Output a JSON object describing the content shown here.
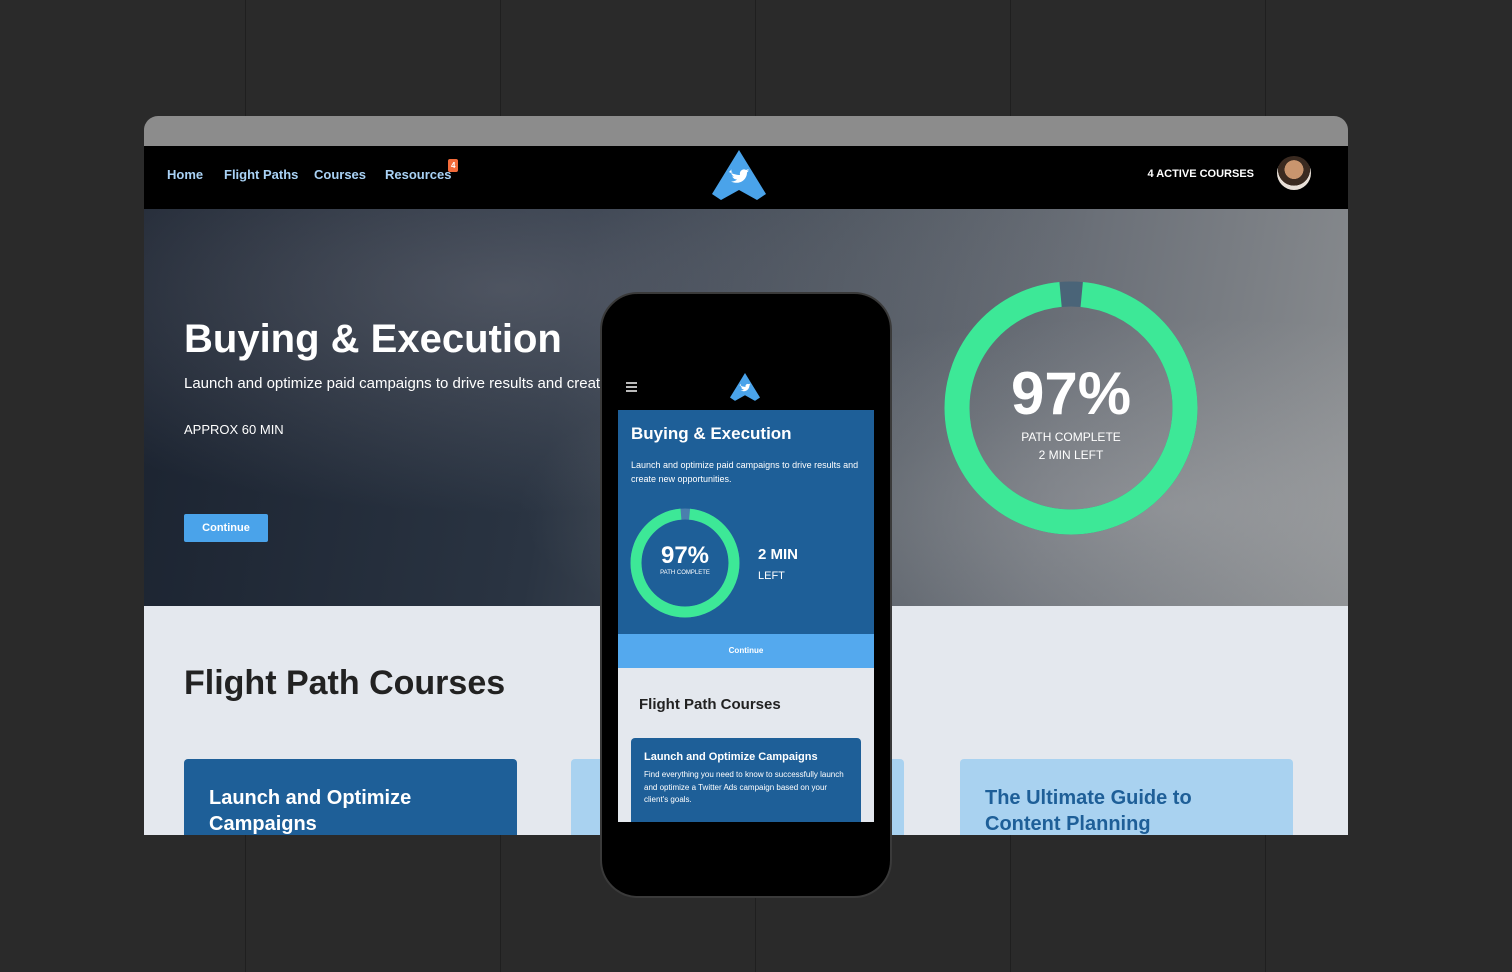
{
  "nav": {
    "items": [
      "Home",
      "Flight Paths",
      "Courses",
      "Resources"
    ],
    "resources_badge": "4",
    "active_courses": "4 ACTIVE COURSES"
  },
  "hero": {
    "title": "Buying & Execution",
    "subtitle": "Launch and optimize paid campaigns to drive results and create new opportunities.",
    "duration": "APPROX 60 MIN",
    "continue": "Continue",
    "progress_percent": 97,
    "percent_label": "97%",
    "path_complete": "PATH COMPLETE",
    "time_left": "2 MIN LEFT"
  },
  "courses": {
    "title": "Flight Path Courses",
    "cards": [
      "Launch and Optimize Campaigns",
      "",
      "The Ultimate Guide to Content Planning"
    ]
  },
  "mobile": {
    "title": "Buying & Execution",
    "subtitle": "Launch and optimize paid campaigns to drive results and create new opportunities.",
    "percent_label": "97%",
    "path_complete": "PATH COMPLETE",
    "min": "2 MIN",
    "left": "LEFT",
    "continue": "Continue",
    "courses_title": "Flight Path Courses",
    "card_title": "Launch and Optimize Campaigns",
    "card_text": "Find everything you need to know to successfully launch and optimize a Twitter Ads campaign based on your client's goals."
  },
  "colors": {
    "accent": "#4aa3ea",
    "progress": "#3de897",
    "badge": "#f36b3a",
    "card_dark": "#1e5f98",
    "card_light": "#a9d2f0"
  }
}
